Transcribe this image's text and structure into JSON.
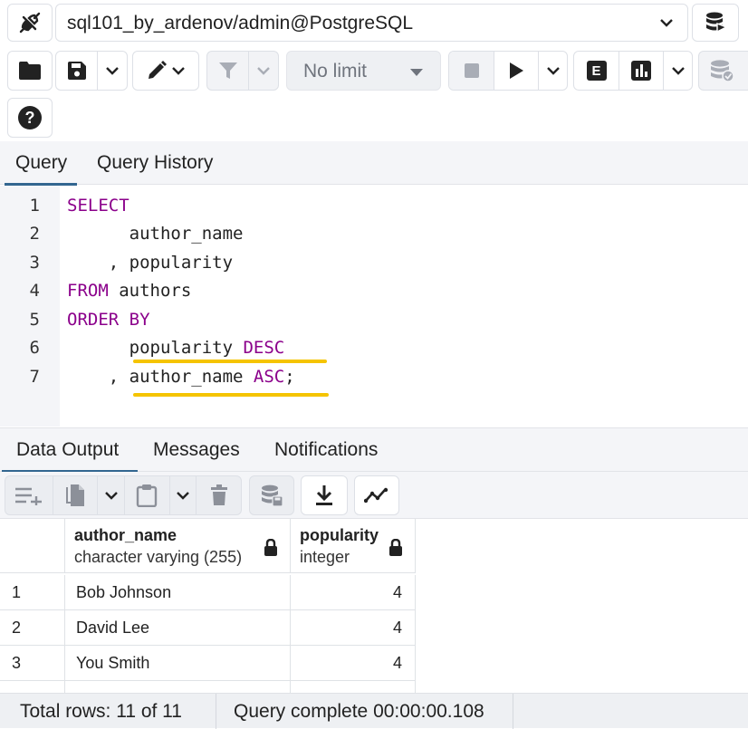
{
  "connection": {
    "label": "sql101_by_ardenov/admin@PostgreSQL",
    "icons": {
      "connection": "plug-connect-icon",
      "database": "database-stack-icon",
      "dropdown": "chevron-down-icon"
    }
  },
  "toolbar": {
    "row_limit": "No limit",
    "icons": [
      "folder-open-icon",
      "save-icon",
      "chevron-down-icon",
      "edit-pencil-icon",
      "filter-icon",
      "stop-icon",
      "play-execute-icon",
      "explain-icon",
      "explain-analyze-icon",
      "commit-icon",
      "help-icon"
    ],
    "explain_letter": "E",
    "help_glyph": "?"
  },
  "editor_tabs": [
    {
      "label": "Query",
      "active": true
    },
    {
      "label": "Query History",
      "active": false
    }
  ],
  "editor": {
    "lines": [
      {
        "n": "1",
        "kw": "SELECT",
        "text": ""
      },
      {
        "n": "2",
        "kw": "",
        "text": "      author_name"
      },
      {
        "n": "3",
        "kw": "",
        "text": "    , popularity"
      },
      {
        "n": "4",
        "kw": "FROM",
        "text": " authors"
      },
      {
        "n": "5",
        "kw": "ORDER BY",
        "text": ""
      },
      {
        "n": "6",
        "kw": "",
        "text": "      popularity ",
        "kw2": "DESC",
        "tail": ""
      },
      {
        "n": "7",
        "kw": "",
        "text": "    , author_name ",
        "kw2": "ASC",
        "tail": ";"
      }
    ],
    "highlight_color": "#f5c400",
    "keyword_color": "#8b008b"
  },
  "output_tabs": [
    {
      "label": "Data Output",
      "active": true
    },
    {
      "label": "Messages",
      "active": false
    },
    {
      "label": "Notifications",
      "active": false
    }
  ],
  "grid_toolbar": {
    "icons": [
      "add-row-icon",
      "copy-icon",
      "chevron-down-icon",
      "paste-icon",
      "chevron-down-icon",
      "delete-icon",
      "save-data-icon",
      "download-icon",
      "graph-visualiser-icon"
    ]
  },
  "results": {
    "columns": [
      {
        "name": "author_name",
        "type": "character varying (255)"
      },
      {
        "name": "popularity",
        "type": "integer"
      }
    ],
    "rows": [
      {
        "n": "1",
        "author_name": "Bob Johnson",
        "popularity": "4"
      },
      {
        "n": "2",
        "author_name": "David Lee",
        "popularity": "4"
      },
      {
        "n": "3",
        "author_name": "You Smith",
        "popularity": "4"
      }
    ]
  },
  "status": {
    "total_rows": "Total rows: 11 of 11",
    "query_complete": "Query complete 00:00:00.108"
  },
  "colors": {
    "accent": "#326690",
    "keyword": "#8b008b",
    "highlight": "#f5c400",
    "panel_bg": "#f4f5f8"
  }
}
